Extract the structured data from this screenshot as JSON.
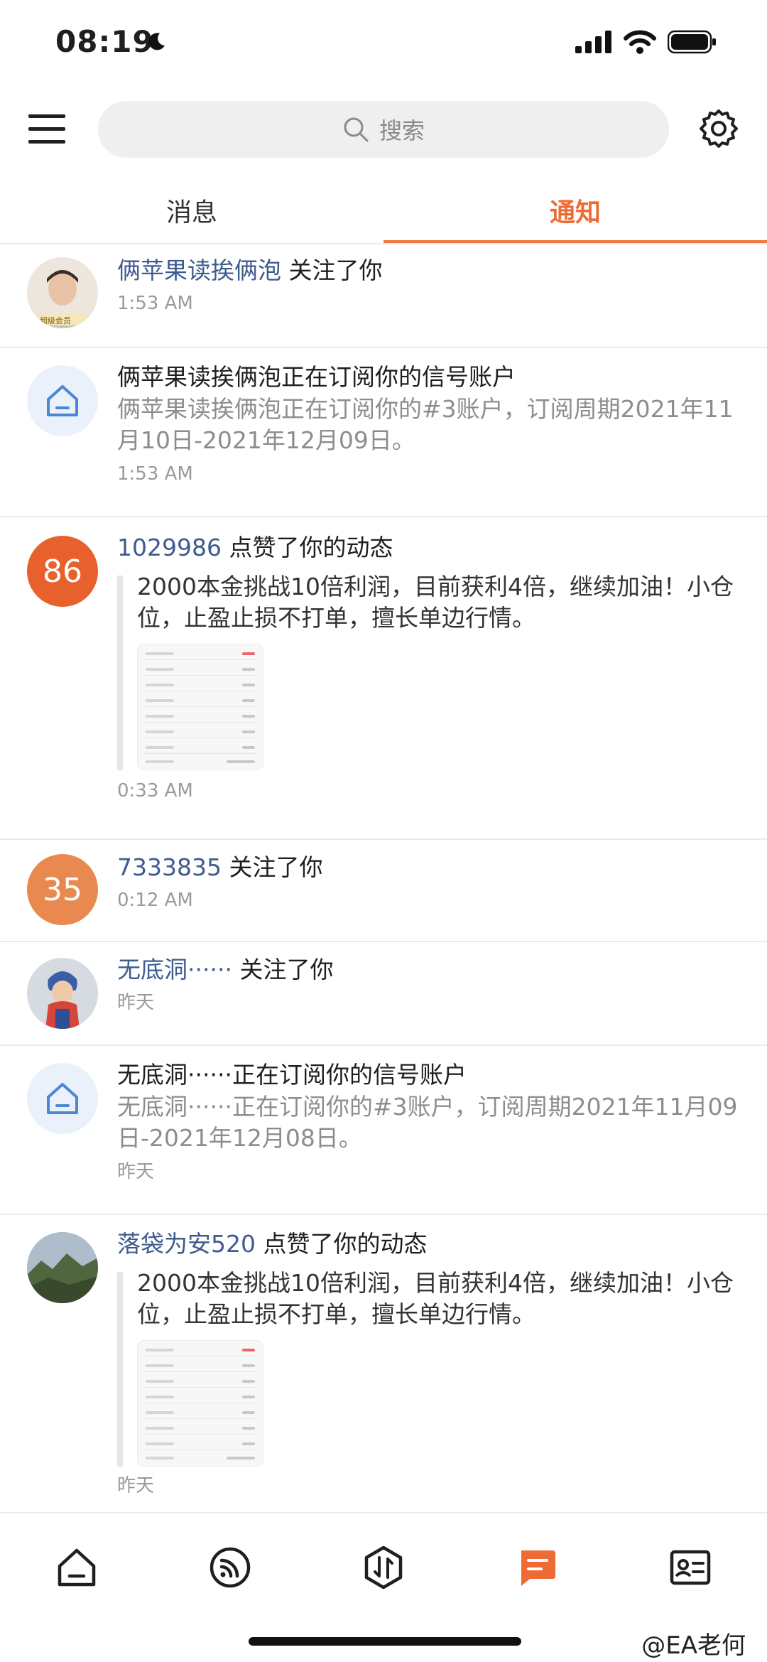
{
  "status": {
    "time": "08:19"
  },
  "header": {
    "search_placeholder": "搜索"
  },
  "tabs": [
    {
      "label": "消息"
    },
    {
      "label": "通知"
    }
  ],
  "notifications": [
    {
      "user": "俩苹果读挨俩泡",
      "action": "关注了你",
      "time": "1:53 AM",
      "avatar_caption": "超级会员"
    },
    {
      "title": "俩苹果读挨俩泡正在订阅你的信号账户",
      "desc": "俩苹果读挨俩泡正在订阅你的#3账户，订阅周期2021年11月10日-2021年12月09日。",
      "time": "1:53 AM"
    },
    {
      "user": "1029986",
      "action": "点赞了你的动态",
      "avatar_text": "86",
      "avatar_color": "#e8602c",
      "quote": "2000本金挑战10倍利润，目前获利4倍，继续加油！小仓位，止盈止损不打单，擅长单边行情。",
      "time": "0:33 AM"
    },
    {
      "user": "7333835",
      "action": "关注了你",
      "avatar_text": "35",
      "avatar_color": "#e9894f",
      "time": "0:12 AM"
    },
    {
      "user": "无底洞······",
      "action": "关注了你",
      "time": "昨天"
    },
    {
      "title": "无底洞······正在订阅你的信号账户",
      "desc": "无底洞······正在订阅你的#3账户，订阅周期2021年11月09日-2021年12月08日。",
      "time": "昨天"
    },
    {
      "user": "落袋为安520",
      "action": "点赞了你的动态",
      "quote": "2000本金挑战10倍利润，目前获利4倍，继续加油！小仓位，止盈止损不打单，擅长单边行情。",
      "time": "昨天"
    }
  ],
  "bottom_nav": [
    {
      "icon": "home-icon"
    },
    {
      "icon": "signal-icon"
    },
    {
      "icon": "trade-icon"
    },
    {
      "icon": "message-icon",
      "active": true
    },
    {
      "icon": "profile-card-icon"
    }
  ],
  "watermark": "@EA老何",
  "colors": {
    "accent": "#ef6b35",
    "username": "#3e5b8f"
  }
}
